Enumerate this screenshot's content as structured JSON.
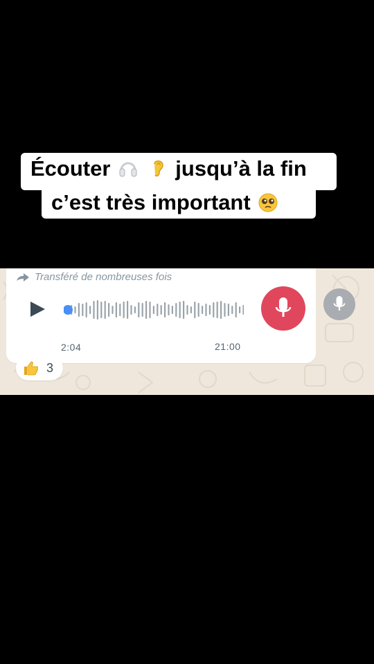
{
  "caption": {
    "line1_part1": "Écouter",
    "line1_part2": "jusqu’à la fin",
    "line2_part1": "c’est très important",
    "icons": [
      "headphones-icon",
      "ear-icon",
      "pleading-face-icon"
    ]
  },
  "message": {
    "forwarded_label": "Transféré de nombreuses fois",
    "voice_note": {
      "elapsed": "2:04",
      "timestamp": "21:00",
      "progress": 0.0,
      "accent_color": "#4a8ff5"
    },
    "reaction": {
      "emoji_icon": "thumbs-up-icon",
      "count": "3"
    }
  },
  "colors": {
    "record_button": "#e0475c",
    "mic_button": "#a9acb0",
    "chat_background": "#efe7dc"
  }
}
